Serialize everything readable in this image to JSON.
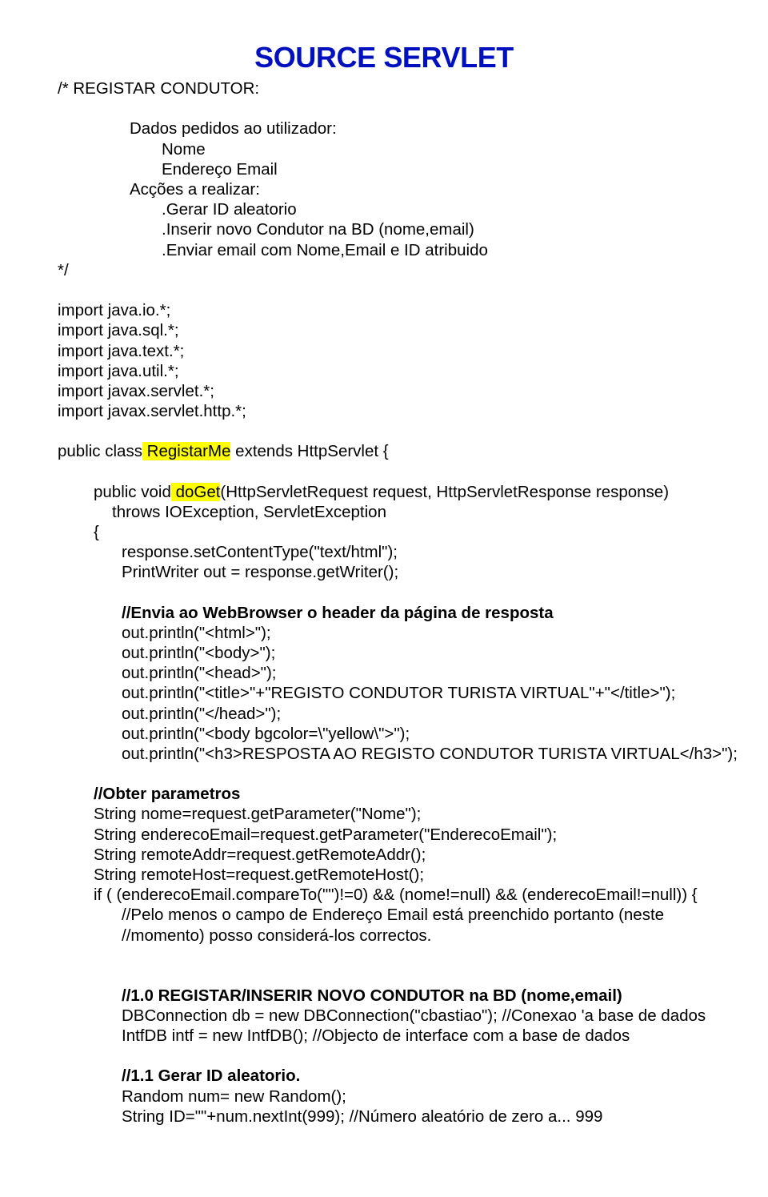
{
  "title": "SOURCE SERVLET",
  "c1": "/* REGISTAR CONDUTOR:",
  "c2": "Dados pedidos ao utilizador:",
  "c3": "Nome",
  "c4": "Endereço Email",
  "c5": "Acções a realizar:",
  "c6": ".Gerar ID aleatorio",
  "c7": ".Inserir novo Condutor na BD (nome,email)",
  "c8": ".Enviar email com Nome,Email e ID atribuido",
  "c9": "*/",
  "imp1": "import java.io.*;",
  "imp2": "import java.sql.*;",
  "imp3": "import java.text.*;",
  "imp4": "import java.util.*;",
  "imp5": "import javax.servlet.*;",
  "imp6": "import javax.servlet.http.*;",
  "cls_pre": "public class",
  "cls_name": " RegistarMe",
  "cls_post": " extends HttpServlet {",
  "m_pre": "public void",
  "m_name": " doGet",
  "m_post": "(HttpServletRequest request, HttpServletResponse response)",
  "m_throws": "throws IOException, ServletException",
  "m_brace": "{",
  "r1": "response.setContentType(\"text/html\");",
  "r2": "PrintWriter out = response.getWriter();",
  "h_cmt": "//Envia ao WebBrowser o header da página de resposta",
  "h1": "out.println(\"<html>\");",
  "h2": "out.println(\"<body>\");",
  "h3": "out.println(\"<head>\");",
  "h4": "out.println(\"<title>\"+\"REGISTO CONDUTOR TURISTA VIRTUAL\"+\"</title>\");",
  "h5": "out.println(\"</head>\");",
  "h6": "out.println(\"<body bgcolor=\\\"yellow\\\">\");",
  "h7": "out.println(\"<h3>RESPOSTA AO REGISTO CONDUTOR TURISTA VIRTUAL</h3>\");",
  "p_cmt": "//Obter parametros",
  "p1": "String nome=request.getParameter(\"Nome\");",
  "p2": "String enderecoEmail=request.getParameter(\"EnderecoEmail\");",
  "p3": "String remoteAddr=request.getRemoteAddr();",
  "p4": "String remoteHost=request.getRemoteHost();",
  "p5": "if ( (enderecoEmail.compareTo(\"\")!=0) && (nome!=null) && (enderecoEmail!=null)) {",
  "p6": "//Pelo menos o campo de Endereço Email está preenchido portanto (neste",
  "p7": "//momento) posso considerá-los correctos.",
  "s1": "//1.0 REGISTAR/INSERIR NOVO CONDUTOR na BD (nome,email)",
  "s2": "DBConnection db = new DBConnection(\"cbastiao\");  //Conexao 'a base de dados",
  "s3": "IntfDB intf = new IntfDB(); //Objecto de interface com a base de  dados",
  "s4": "//1.1 Gerar ID aleatorio.",
  "s5": "Random num= new Random();",
  "s6": "String ID=\"\"+num.nextInt(999);  //Número aleatório de zero a... 999"
}
